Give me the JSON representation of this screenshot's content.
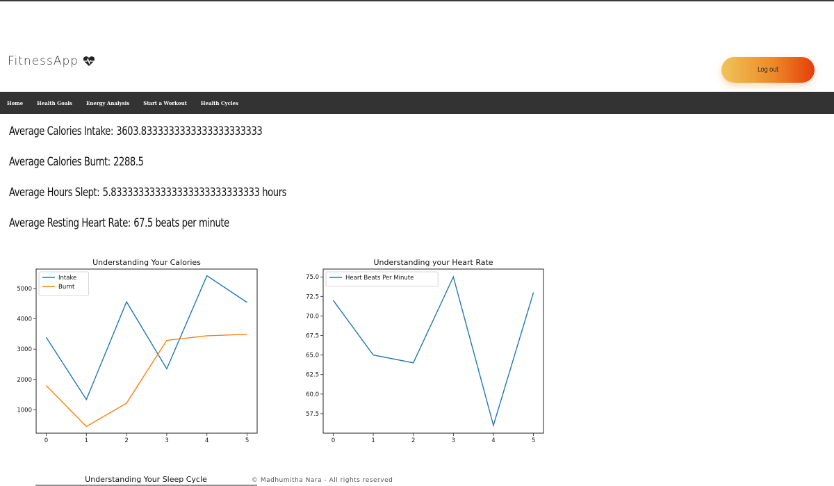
{
  "app": {
    "title": "FitnessApp",
    "logo_icon": "heart-pulse-icon",
    "logout_label": "Log out",
    "logout_gradient": [
      "#f0c459",
      "#e63e0b"
    ]
  },
  "nav": {
    "items": [
      {
        "label": "Home"
      },
      {
        "label": "Health Goals"
      },
      {
        "label": "Energy Analysis"
      },
      {
        "label": "Start a Workout"
      },
      {
        "label": "Health Cycles"
      }
    ],
    "background": "#333333"
  },
  "stats": [
    {
      "label": "Average Calories Intake:",
      "value": "3603.8333333333333333333333"
    },
    {
      "label": "Average Calories Burnt:",
      "value": "2288.5"
    },
    {
      "label": "Average Hours Slept:",
      "value": "5.833333333333333333333333333 hours"
    },
    {
      "label": "Average Resting Heart Rate:",
      "value": "67.5 beats per minute"
    }
  ],
  "chart_data": [
    {
      "type": "line",
      "title": "Understanding Your Calories",
      "x": [
        0,
        1,
        2,
        3,
        4,
        5
      ],
      "xlim": [
        -0.25,
        5.25
      ],
      "ylim": [
        230,
        5640
      ],
      "yticks": [
        1000,
        2000,
        3000,
        4000,
        5000
      ],
      "series": [
        {
          "name": "Intake",
          "color": "#1f77b4",
          "values": [
            3390,
            1340,
            4560,
            2350,
            5420,
            4540
          ]
        },
        {
          "name": "Burnt",
          "color": "#ff7f0e",
          "values": [
            1800,
            450,
            1220,
            3290,
            3440,
            3490
          ]
        }
      ],
      "legend": "upper-left",
      "grid": false
    },
    {
      "type": "line",
      "title": "Understanding your Heart Rate",
      "x": [
        0,
        1,
        2,
        3,
        4,
        5
      ],
      "xlim": [
        -0.25,
        5.25
      ],
      "ylim": [
        55,
        76
      ],
      "yticks": [
        57.5,
        60.0,
        62.5,
        65.0,
        67.5,
        70.0,
        72.5,
        75.0
      ],
      "series": [
        {
          "name": "Heart Beats Per Minute",
          "color": "#1f77b4",
          "values": [
            72,
            65,
            64,
            75,
            56,
            73
          ]
        }
      ],
      "legend": "upper-left",
      "grid": false
    }
  ],
  "sleep_chart": {
    "title": "Understanding Your Sleep Cycle"
  },
  "footer": "© Madhumitha Nara - All rights reserved"
}
